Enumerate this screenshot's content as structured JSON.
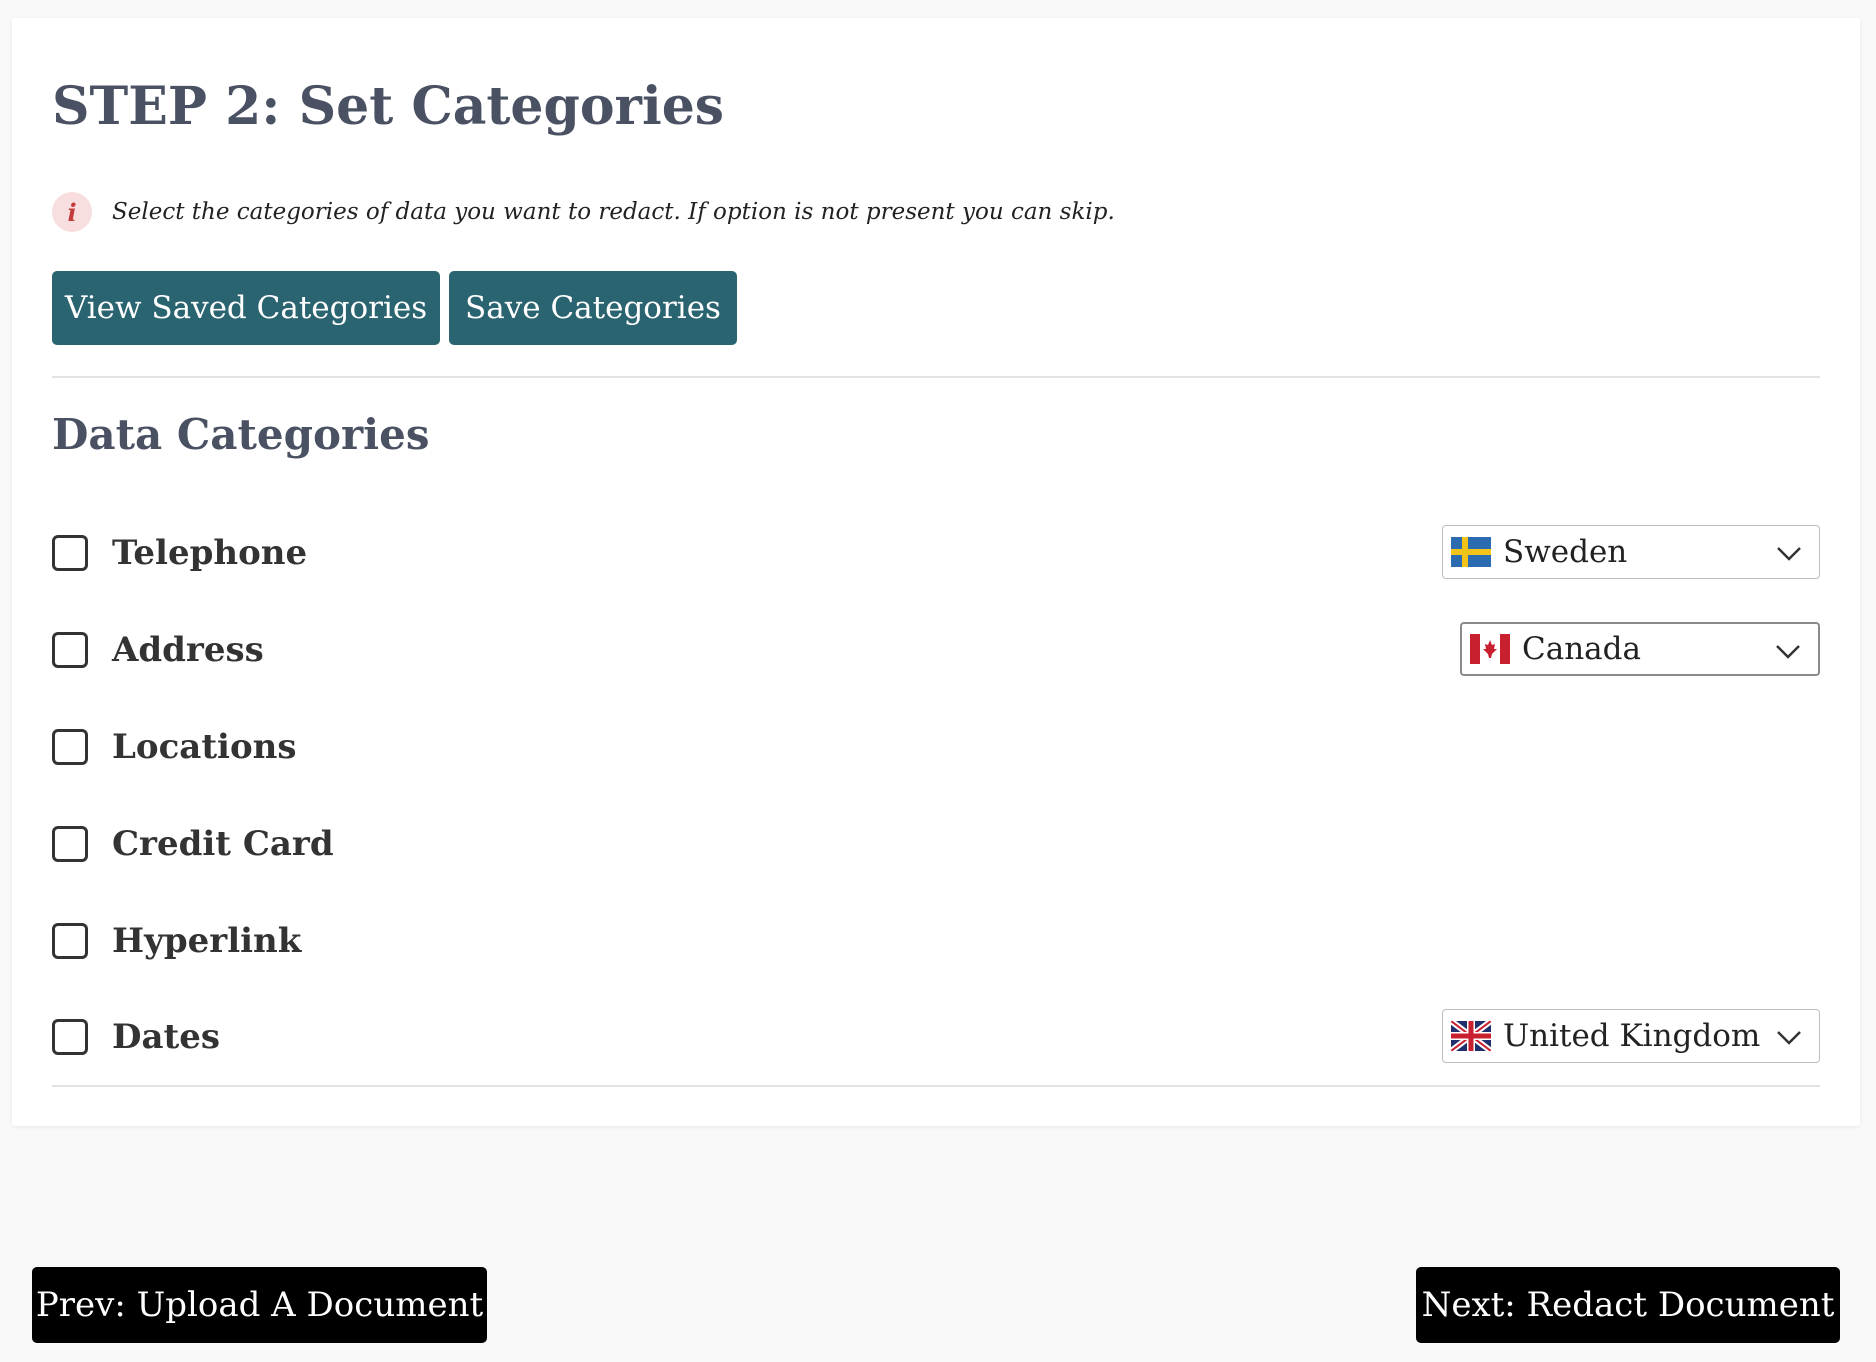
{
  "header": {
    "title": "STEP 2: Set Categories",
    "info_icon": "info-icon",
    "info_text": "Select the categories of data you want to redact. If option is not present you can skip."
  },
  "actions": {
    "view_saved_label": "View Saved Categories",
    "save_label": "Save Categories"
  },
  "categories_section": {
    "title": "Data Categories",
    "items": [
      {
        "label": "Telephone",
        "checked": false,
        "country": "Sweden",
        "flag": "sweden-flag-icon"
      },
      {
        "label": "Address",
        "checked": false,
        "country": "Canada",
        "flag": "canada-flag-icon"
      },
      {
        "label": "Locations",
        "checked": false
      },
      {
        "label": "Credit Card",
        "checked": false
      },
      {
        "label": "Hyperlink",
        "checked": false
      },
      {
        "label": "Dates",
        "checked": false,
        "country": "United Kingdom",
        "flag": "uk-flag-icon"
      }
    ]
  },
  "navigation": {
    "prev_label": "Prev: Upload A Document",
    "next_label": "Next: Redact Document"
  },
  "colors": {
    "primary_button": "#2a6470",
    "nav_button": "#000000",
    "heading": "#4a5163",
    "info_icon_bg": "#f8dede",
    "info_icon_fg": "#c43b3b"
  }
}
